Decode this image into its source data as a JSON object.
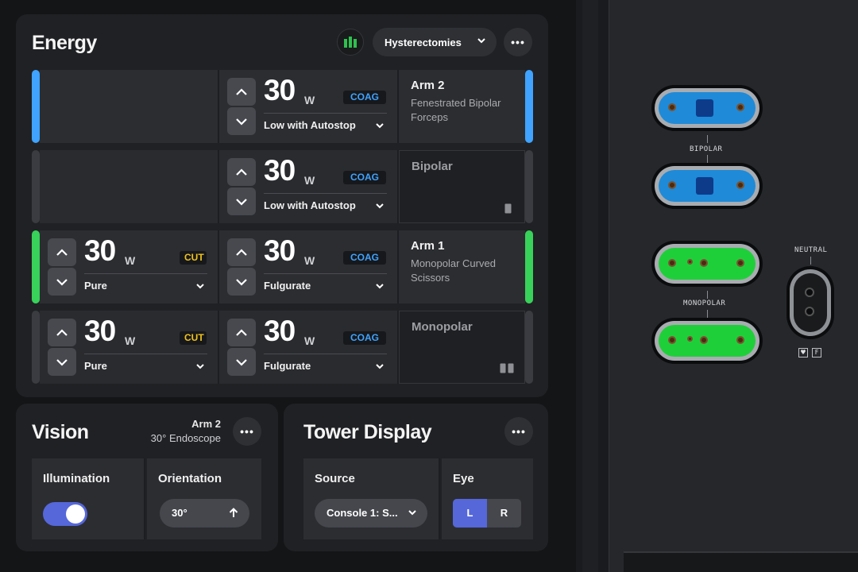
{
  "energy": {
    "title": "Energy",
    "preset": "Hysterectomies",
    "rows": [
      {
        "accent": "#3fa3ff",
        "active": true,
        "controls": [
          {
            "value": "30",
            "unit": "W",
            "mode": "COAG",
            "setting": "Low with Autostop"
          }
        ],
        "info_title": "Arm 2",
        "info_sub": "Fenestrated Bipolar Forceps"
      },
      {
        "accent": "#3a3c41",
        "active": false,
        "controls": [
          {
            "value": "30",
            "unit": "W",
            "mode": "COAG",
            "setting": "Low with Autostop"
          }
        ],
        "info_title": "Bipolar",
        "info_sub": ""
      },
      {
        "accent": "#38d15a",
        "active": true,
        "controls": [
          {
            "value": "30",
            "unit": "W",
            "mode": "CUT",
            "setting": "Pure"
          },
          {
            "value": "30",
            "unit": "W",
            "mode": "COAG",
            "setting": "Fulgurate"
          }
        ],
        "info_title": "Arm 1",
        "info_sub": "Monopolar Curved Scissors"
      },
      {
        "accent": "#3a3c41",
        "active": false,
        "controls": [
          {
            "value": "30",
            "unit": "W",
            "mode": "CUT",
            "setting": "Pure"
          },
          {
            "value": "30",
            "unit": "W",
            "mode": "COAG",
            "setting": "Fulgurate"
          }
        ],
        "info_title": "Monopolar",
        "info_sub": ""
      }
    ]
  },
  "vision": {
    "title": "Vision",
    "arm": "Arm 2",
    "scope": "30° Endoscope",
    "illumination_label": "Illumination",
    "illumination_on": true,
    "orientation_label": "Orientation",
    "orientation_value": "30°"
  },
  "tower": {
    "title": "Tower Display",
    "source_label": "Source",
    "source_value": "Console 1: S...",
    "eye_label": "Eye",
    "eye_left": "L",
    "eye_right": "R",
    "eye_selected": "L"
  },
  "hardware": {
    "bipolar_label": "BIPOLAR",
    "monopolar_label": "MONOPOLAR",
    "neutral_label": "NEUTRAL",
    "symbol_f": "F",
    "symbol_heart": "♥",
    "bipolar_color": "#1f8ad8",
    "monopolar_color": "#1fcf3a"
  }
}
